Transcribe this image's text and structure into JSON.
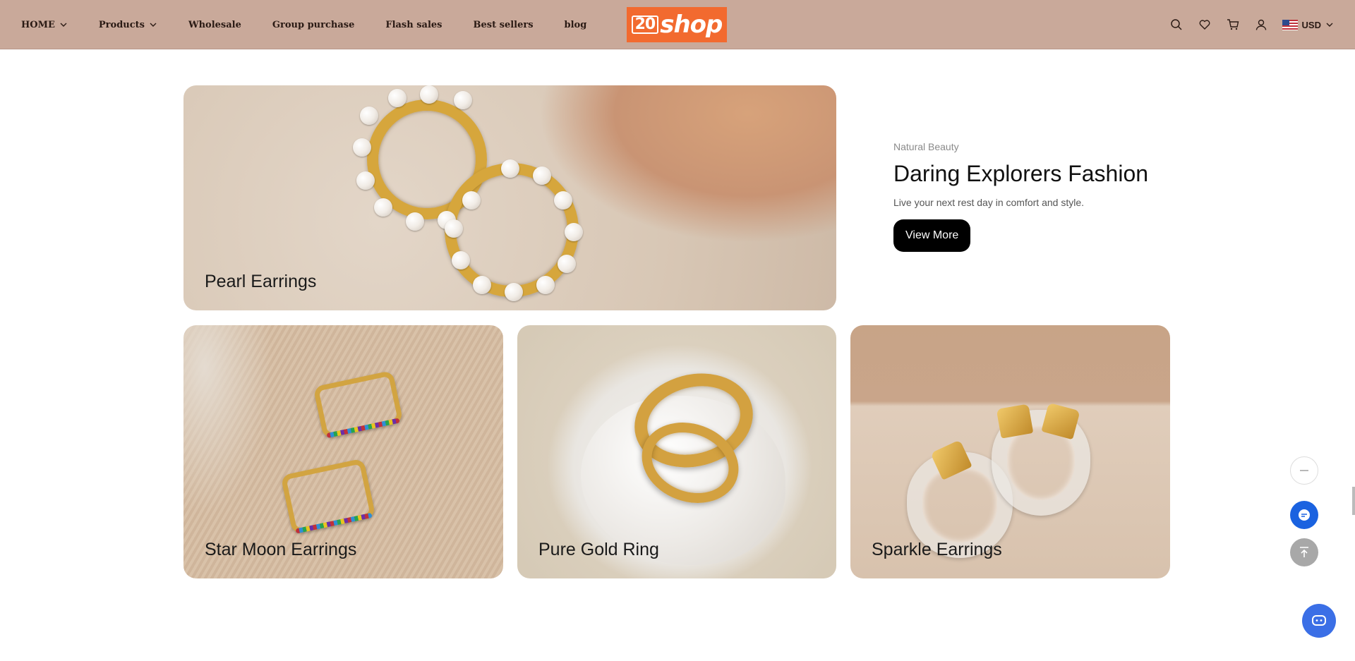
{
  "header": {
    "nav": [
      {
        "label": "HOME",
        "has_dropdown": true
      },
      {
        "label": "Products",
        "has_dropdown": true
      },
      {
        "label": "Wholesale",
        "has_dropdown": false
      },
      {
        "label": "Group purchase",
        "has_dropdown": false
      },
      {
        "label": "Flash sales",
        "has_dropdown": false
      },
      {
        "label": "Best sellers",
        "has_dropdown": false
      },
      {
        "label": "blog",
        "has_dropdown": false
      }
    ],
    "logo_text": "shop",
    "logo_prefix": "20",
    "currency": "USD",
    "icons": [
      "search-icon",
      "heart-icon",
      "cart-icon",
      "user-icon"
    ]
  },
  "banners": {
    "main_label": "Pearl Earrings",
    "tiles": [
      {
        "label": "Star Moon Earrings"
      },
      {
        "label": "Pure Gold Ring"
      },
      {
        "label": "Sparkle Earrings"
      }
    ]
  },
  "promo": {
    "eyebrow": "Natural Beauty",
    "title": "Daring Explorers Fashion",
    "subtitle": "Live your next rest day in comfort and style.",
    "button": "View More"
  },
  "colors": {
    "header_bg": "#c9a99a",
    "logo_bg": "#f26a2f",
    "button_bg": "#000000",
    "chat_blue": "#1a62e0"
  }
}
